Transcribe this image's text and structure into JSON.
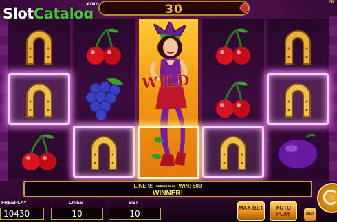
{
  "logo": {
    "slot": "Slot",
    "catalog": "Catalog",
    "com": ".com"
  },
  "top": {
    "win_value": "30",
    "fr_label": "FR"
  },
  "reels": {
    "symbols": [
      [
        "horseshoe",
        "horseshoe",
        "cherry"
      ],
      [
        "cherry",
        "grapes",
        "horseshoe"
      ],
      [
        "jester-lady",
        "jester-lady",
        "jester-lady"
      ],
      [
        "cherry",
        "cherry",
        "horseshoe"
      ],
      [
        "horseshoe",
        "horseshoe",
        "plum"
      ]
    ],
    "wild_label": "WILD"
  },
  "info": {
    "line_label": "LINE 9:",
    "line_symbols": "∞∞∞∞∞",
    "win_label": "WIN: 500",
    "status": "WINNER!"
  },
  "bottom": {
    "freeplay_label": "FREEPLAY",
    "freeplay_value": "10430",
    "lines_label": "LINES",
    "lines_value": "10",
    "bet_label": "BET",
    "bet_value": "10",
    "maxbet_label": "MAX BET",
    "autoplay_label": "AUTO PLAY",
    "bet_small_label": "BET"
  },
  "colors": {
    "accent_gold": "#c9a233",
    "highlight": "#f7d6ff",
    "win_text": "#f3c23a"
  }
}
